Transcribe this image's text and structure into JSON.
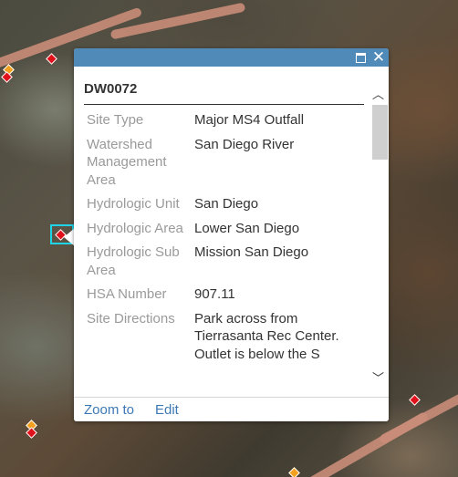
{
  "popup": {
    "title": "DW0072",
    "maximize_icon": "maximize-icon",
    "close_icon": "close-icon",
    "attributes": [
      {
        "label": "Site Type",
        "value": "Major MS4 Outfall"
      },
      {
        "label": "Watershed Management Area",
        "value": "San Diego River"
      },
      {
        "label": "Hydrologic Unit",
        "value": "San Diego"
      },
      {
        "label": "Hydrologic Area",
        "value": "Lower San Diego"
      },
      {
        "label": "Hydrologic Sub Area",
        "value": "Mission San Diego"
      },
      {
        "label": "HSA Number",
        "value": "907.11"
      },
      {
        "label": "Site Directions",
        "value": "Park across from Tierrasanta Rec Center. Outlet is below the S"
      }
    ],
    "actions": {
      "zoom_to": "Zoom to",
      "edit": "Edit"
    }
  },
  "map": {
    "marker_colors": {
      "primary": "#e0111b",
      "secondary": "#f2a01d"
    },
    "selection_color": "#20d4e8",
    "header_color": "#4f8ab9"
  }
}
